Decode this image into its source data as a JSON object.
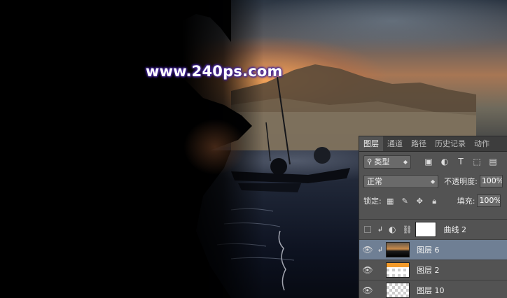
{
  "watermark": "www.240ps.com",
  "panel": {
    "tabs": [
      "图层",
      "通道",
      "路径",
      "历史记录",
      "动作"
    ],
    "active_tab": 0,
    "filter": {
      "label": "类型"
    },
    "blend_mode": "正常",
    "opacity": {
      "label": "不透明度:",
      "value": "100%"
    },
    "lock": {
      "label": "锁定:"
    },
    "fill": {
      "label": "填充:",
      "value": "100%"
    },
    "layers": [
      {
        "name": "曲线 2",
        "visible": false,
        "type": "adjustment",
        "clipped": true,
        "selected": false
      },
      {
        "name": "图层 6",
        "visible": true,
        "type": "photo",
        "clipped": true,
        "selected": true
      },
      {
        "name": "图层 2",
        "visible": true,
        "type": "orange",
        "clipped": false,
        "selected": false
      },
      {
        "name": "图层 10",
        "visible": true,
        "type": "transparent",
        "clipped": false,
        "selected": false
      }
    ]
  },
  "colors": {
    "panel_bg": "#535353",
    "selected_row": "#6f7f94",
    "watermark_glow": "#4a2aa0"
  }
}
